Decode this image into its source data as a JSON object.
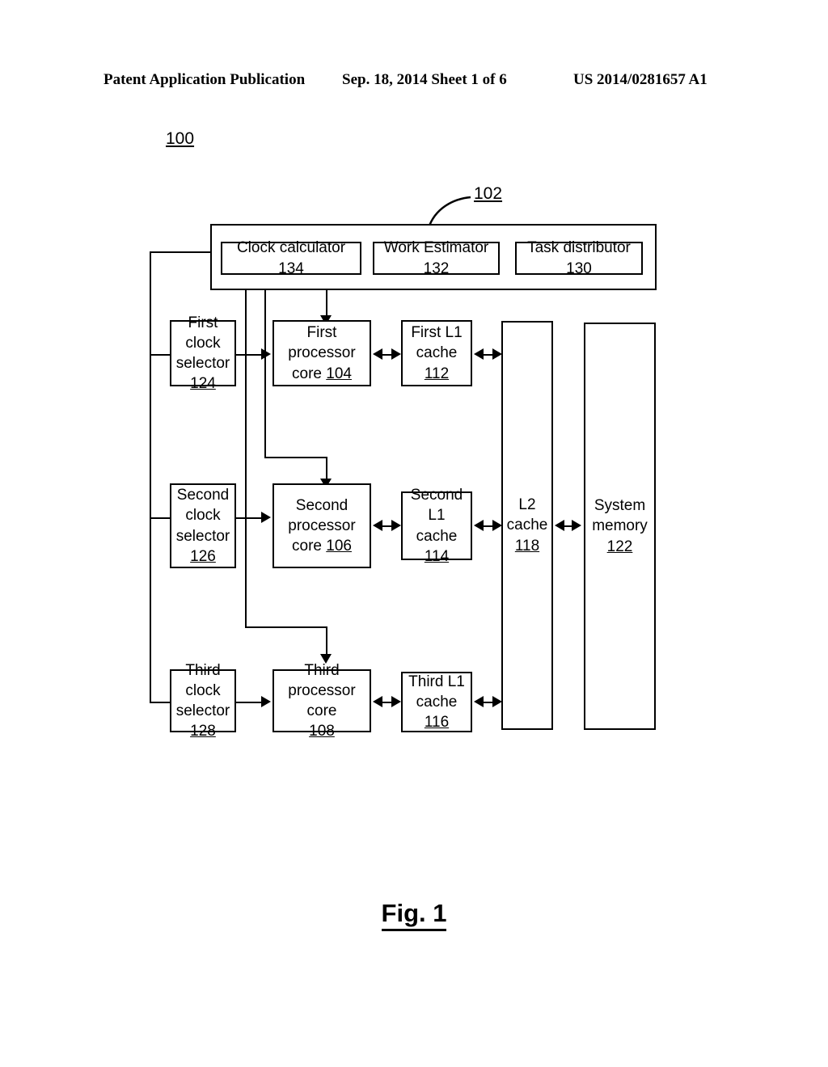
{
  "header": {
    "left": "Patent Application Publication",
    "middle": "Sep. 18, 2014   Sheet 1 of 6",
    "right": "US 2014/0281657 A1"
  },
  "figure": {
    "system_ref": "100",
    "container_ref": "102",
    "caption": "Fig. 1"
  },
  "control_block": {
    "items": [
      {
        "label": "Clock calculator",
        "ref": "134"
      },
      {
        "label": "Work Estimator",
        "ref": "132"
      },
      {
        "label": "Task distributor",
        "ref": "130"
      }
    ]
  },
  "clock_selectors": [
    {
      "line1": "First clock",
      "line2": "selector",
      "ref": "124"
    },
    {
      "line1": "Second",
      "line2": "clock",
      "line3": "selector",
      "ref": "126"
    },
    {
      "line1": "Third clock",
      "line2": "selector",
      "ref": "128"
    }
  ],
  "cores": [
    {
      "line1": "First processor",
      "line2": "core",
      "ref": "104"
    },
    {
      "line1": "Second",
      "line2": "processor",
      "line3": "core",
      "ref": "106"
    },
    {
      "line1": "Third",
      "line2": "processor core",
      "ref": "108"
    }
  ],
  "l1_caches": [
    {
      "line1": "First L1",
      "line2": "cache",
      "ref": "112"
    },
    {
      "line1": "Second L1",
      "line2": "cache",
      "ref": "114"
    },
    {
      "line1": "Third L1",
      "line2": "cache",
      "ref": "116"
    }
  ],
  "l2_cache": {
    "line1": "L2",
    "line2": "cache",
    "ref": "118"
  },
  "system_memory": {
    "line1": "System",
    "line2": "memory",
    "ref": "122"
  }
}
